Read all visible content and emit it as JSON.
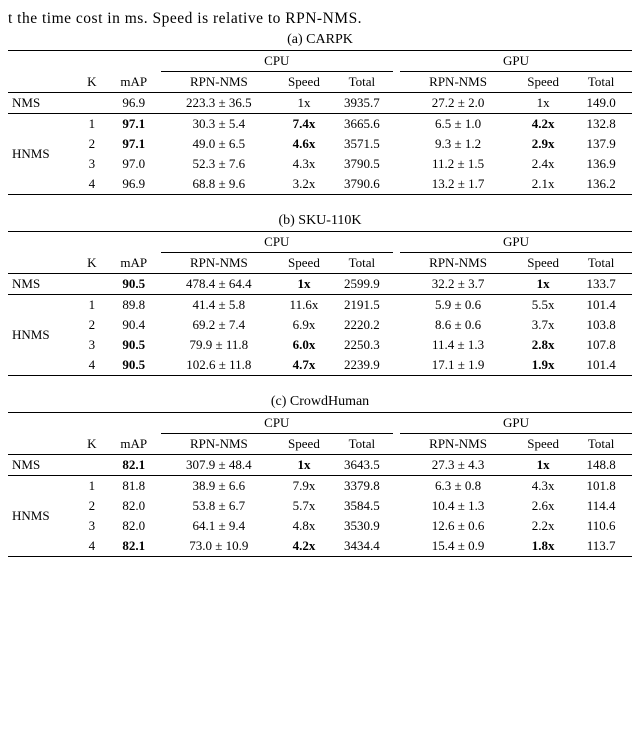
{
  "caption": "t the time cost in ms. Speed is relative to RPN-NMS.",
  "headers": {
    "K": "K",
    "mAP": "mAP",
    "CPU": "CPU",
    "GPU": "GPU",
    "RPN": "RPN-NMS",
    "Speed": "Speed",
    "Total": "Total",
    "NMS": "NMS",
    "HNMS": "HNMS"
  },
  "tables": [
    {
      "label": "(a) CARPK",
      "nms": {
        "K": "",
        "mAP": "96.9",
        "mAP_bold": false,
        "cpu_rpn": "223.3 ± 36.5",
        "cpu_speed": "1x",
        "cpu_speed_bold": false,
        "cpu_total": "3935.7",
        "gpu_rpn": "27.2 ± 2.0",
        "gpu_speed": "1x",
        "gpu_speed_bold": false,
        "gpu_total": "149.0"
      },
      "hnms": [
        {
          "K": "1",
          "mAP": "97.1",
          "mAP_bold": true,
          "cpu_rpn": "30.3 ± 5.4",
          "cpu_speed": "7.4x",
          "cpu_speed_bold": true,
          "cpu_total": "3665.6",
          "gpu_rpn": "6.5 ± 1.0",
          "gpu_speed": "4.2x",
          "gpu_speed_bold": true,
          "gpu_total": "132.8"
        },
        {
          "K": "2",
          "mAP": "97.1",
          "mAP_bold": true,
          "cpu_rpn": "49.0 ± 6.5",
          "cpu_speed": "4.6x",
          "cpu_speed_bold": true,
          "cpu_total": "3571.5",
          "gpu_rpn": "9.3 ± 1.2",
          "gpu_speed": "2.9x",
          "gpu_speed_bold": true,
          "gpu_total": "137.9"
        },
        {
          "K": "3",
          "mAP": "97.0",
          "mAP_bold": false,
          "cpu_rpn": "52.3 ± 7.6",
          "cpu_speed": "4.3x",
          "cpu_speed_bold": false,
          "cpu_total": "3790.5",
          "gpu_rpn": "11.2 ± 1.5",
          "gpu_speed": "2.4x",
          "gpu_speed_bold": false,
          "gpu_total": "136.9"
        },
        {
          "K": "4",
          "mAP": "96.9",
          "mAP_bold": false,
          "cpu_rpn": "68.8 ± 9.6",
          "cpu_speed": "3.2x",
          "cpu_speed_bold": false,
          "cpu_total": "3790.6",
          "gpu_rpn": "13.2 ± 1.7",
          "gpu_speed": "2.1x",
          "gpu_speed_bold": false,
          "gpu_total": "136.2"
        }
      ]
    },
    {
      "label": "(b) SKU-110K",
      "nms": {
        "K": "",
        "mAP": "90.5",
        "mAP_bold": true,
        "cpu_rpn": "478.4 ± 64.4",
        "cpu_speed": "1x",
        "cpu_speed_bold": true,
        "cpu_total": "2599.9",
        "gpu_rpn": "32.2 ± 3.7",
        "gpu_speed": "1x",
        "gpu_speed_bold": true,
        "gpu_total": "133.7"
      },
      "hnms": [
        {
          "K": "1",
          "mAP": "89.8",
          "mAP_bold": false,
          "cpu_rpn": "41.4 ± 5.8",
          "cpu_speed": "11.6x",
          "cpu_speed_bold": false,
          "cpu_total": "2191.5",
          "gpu_rpn": "5.9 ± 0.6",
          "gpu_speed": "5.5x",
          "gpu_speed_bold": false,
          "gpu_total": "101.4"
        },
        {
          "K": "2",
          "mAP": "90.4",
          "mAP_bold": false,
          "cpu_rpn": "69.2 ± 7.4",
          "cpu_speed": "6.9x",
          "cpu_speed_bold": false,
          "cpu_total": "2220.2",
          "gpu_rpn": "8.6 ± 0.6",
          "gpu_speed": "3.7x",
          "gpu_speed_bold": false,
          "gpu_total": "103.8"
        },
        {
          "K": "3",
          "mAP": "90.5",
          "mAP_bold": true,
          "cpu_rpn": "79.9 ± 11.8",
          "cpu_speed": "6.0x",
          "cpu_speed_bold": true,
          "cpu_total": "2250.3",
          "gpu_rpn": "11.4 ± 1.3",
          "gpu_speed": "2.8x",
          "gpu_speed_bold": true,
          "gpu_total": "107.8"
        },
        {
          "K": "4",
          "mAP": "90.5",
          "mAP_bold": true,
          "cpu_rpn": "102.6 ± 11.8",
          "cpu_speed": "4.7x",
          "cpu_speed_bold": true,
          "cpu_total": "2239.9",
          "gpu_rpn": "17.1 ± 1.9",
          "gpu_speed": "1.9x",
          "gpu_speed_bold": true,
          "gpu_total": "101.4"
        }
      ]
    },
    {
      "label": "(c) CrowdHuman",
      "nms": {
        "K": "",
        "mAP": "82.1",
        "mAP_bold": true,
        "cpu_rpn": "307.9 ± 48.4",
        "cpu_speed": "1x",
        "cpu_speed_bold": true,
        "cpu_total": "3643.5",
        "gpu_rpn": "27.3 ± 4.3",
        "gpu_speed": "1x",
        "gpu_speed_bold": true,
        "gpu_total": "148.8"
      },
      "hnms": [
        {
          "K": "1",
          "mAP": "81.8",
          "mAP_bold": false,
          "cpu_rpn": "38.9 ± 6.6",
          "cpu_speed": "7.9x",
          "cpu_speed_bold": false,
          "cpu_total": "3379.8",
          "gpu_rpn": "6.3 ± 0.8",
          "gpu_speed": "4.3x",
          "gpu_speed_bold": false,
          "gpu_total": "101.8"
        },
        {
          "K": "2",
          "mAP": "82.0",
          "mAP_bold": false,
          "cpu_rpn": "53.8 ± 6.7",
          "cpu_speed": "5.7x",
          "cpu_speed_bold": false,
          "cpu_total": "3584.5",
          "gpu_rpn": "10.4 ± 1.3",
          "gpu_speed": "2.6x",
          "gpu_speed_bold": false,
          "gpu_total": "114.4"
        },
        {
          "K": "3",
          "mAP": "82.0",
          "mAP_bold": false,
          "cpu_rpn": "64.1 ± 9.4",
          "cpu_speed": "4.8x",
          "cpu_speed_bold": false,
          "cpu_total": "3530.9",
          "gpu_rpn": "12.6 ± 0.6",
          "gpu_speed": "2.2x",
          "gpu_speed_bold": false,
          "gpu_total": "110.6"
        },
        {
          "K": "4",
          "mAP": "82.1",
          "mAP_bold": true,
          "cpu_rpn": "73.0 ± 10.9",
          "cpu_speed": "4.2x",
          "cpu_speed_bold": true,
          "cpu_total": "3434.4",
          "gpu_rpn": "15.4 ± 0.9",
          "gpu_speed": "1.8x",
          "gpu_speed_bold": true,
          "gpu_total": "113.7"
        }
      ]
    }
  ],
  "chart_data": [
    {
      "type": "table",
      "title": "(a) CARPK"
    },
    {
      "type": "table",
      "title": "(b) SKU-110K"
    },
    {
      "type": "table",
      "title": "(c) CrowdHuman"
    }
  ]
}
